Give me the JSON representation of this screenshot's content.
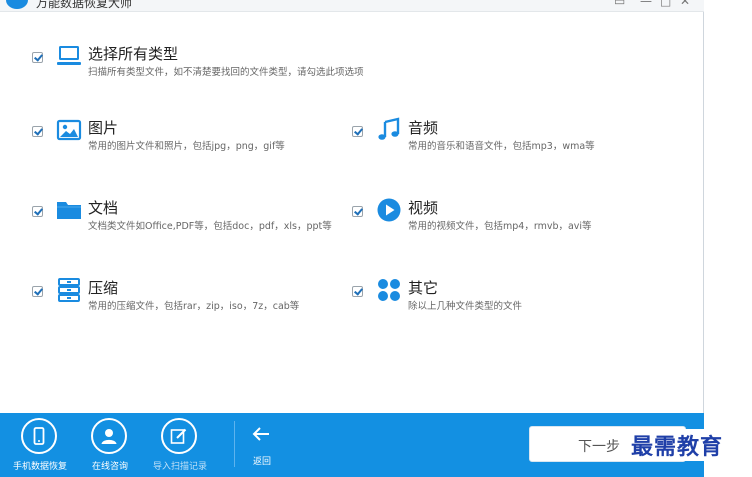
{
  "window": {
    "title": "万能数据恢复大师",
    "controls": [
      "menu-icon",
      "minimize-icon",
      "restore-icon",
      "close-icon"
    ]
  },
  "options": {
    "all": {
      "title": "选择所有类型",
      "desc": "扫描所有类型文件，如不清楚要找回的文件类型，请勾选此项选项",
      "checked": true,
      "icon": "monitor-icon"
    },
    "image": {
      "title": "图片",
      "desc": "常用的图片文件和照片，包括jpg，png，gif等",
      "checked": true,
      "icon": "image-icon"
    },
    "audio": {
      "title": "音频",
      "desc": "常用的音乐和语音文件，包括mp3，wma等",
      "checked": true,
      "icon": "music-note-icon"
    },
    "document": {
      "title": "文档",
      "desc": "文档类文件如Office,PDF等，包括doc，pdf，xls，ppt等",
      "checked": true,
      "icon": "folder-icon"
    },
    "video": {
      "title": "视频",
      "desc": "常用的视频文件，包括mp4，rmvb，avi等",
      "checked": true,
      "icon": "play-icon"
    },
    "archive": {
      "title": "压缩",
      "desc": "常用的压缩文件，包括rar，zip，iso，7z，cab等",
      "checked": true,
      "icon": "archive-icon"
    },
    "other": {
      "title": "其它",
      "desc": "除以上几种文件类型的文件",
      "checked": true,
      "icon": "dots-icon"
    }
  },
  "bottombar": {
    "phone_recovery": "手机数据恢复",
    "online_consult": "在线咨询",
    "import_scan": "导入扫描记录",
    "back": "返回",
    "next": "下一步"
  },
  "watermark": "最需教育",
  "colors": {
    "accent": "#1390e2",
    "icon_blue": "#1a8be0",
    "checkmark": "#1f6fb8",
    "watermark": "#1f3fa8"
  }
}
